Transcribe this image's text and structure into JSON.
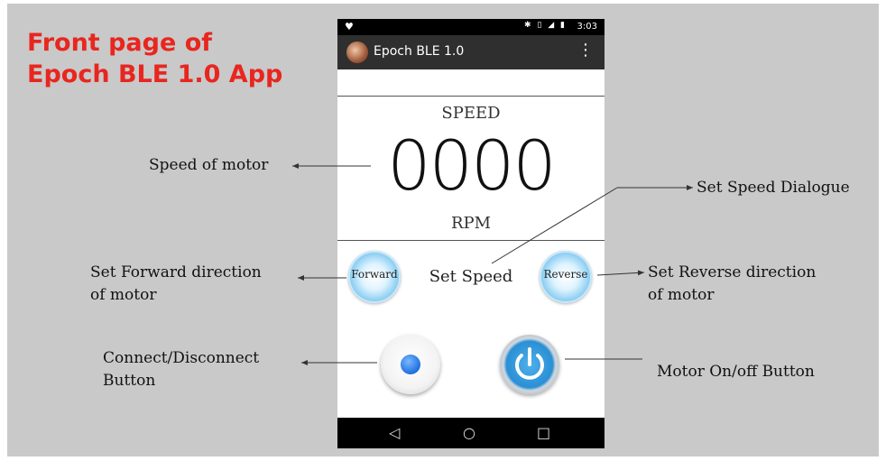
{
  "slide_title": [
    "Front page of",
    "Epoch BLE 1.0 App"
  ],
  "phone": {
    "status_time": "3:03",
    "app_title": "Epoch BLE 1.0",
    "speed_label": "SPEED",
    "speed_value": "0000",
    "rpm_label": "RPM",
    "forward_label": "Forward",
    "reverse_label": "Reverse",
    "set_speed_label": "Set Speed"
  },
  "callouts": {
    "speed_of_motor": "Speed of motor",
    "set_speed_dialogue": "Set Speed Dialogue",
    "set_forward": [
      "Set Forward direction",
      "of motor"
    ],
    "set_reverse": [
      "Set Reverse direction",
      "of motor"
    ],
    "connect": [
      "Connect/Disconnect",
      "Button"
    ],
    "motor_onoff": "Motor On/off Button"
  },
  "colors": {
    "title_red": "#e8261f",
    "accent_blue": "#2a8fd5"
  },
  "icons": {
    "status_left": "heart-icon",
    "menu": "overflow-menu-icon",
    "nav": [
      "back-icon",
      "home-icon",
      "recents-icon"
    ]
  }
}
